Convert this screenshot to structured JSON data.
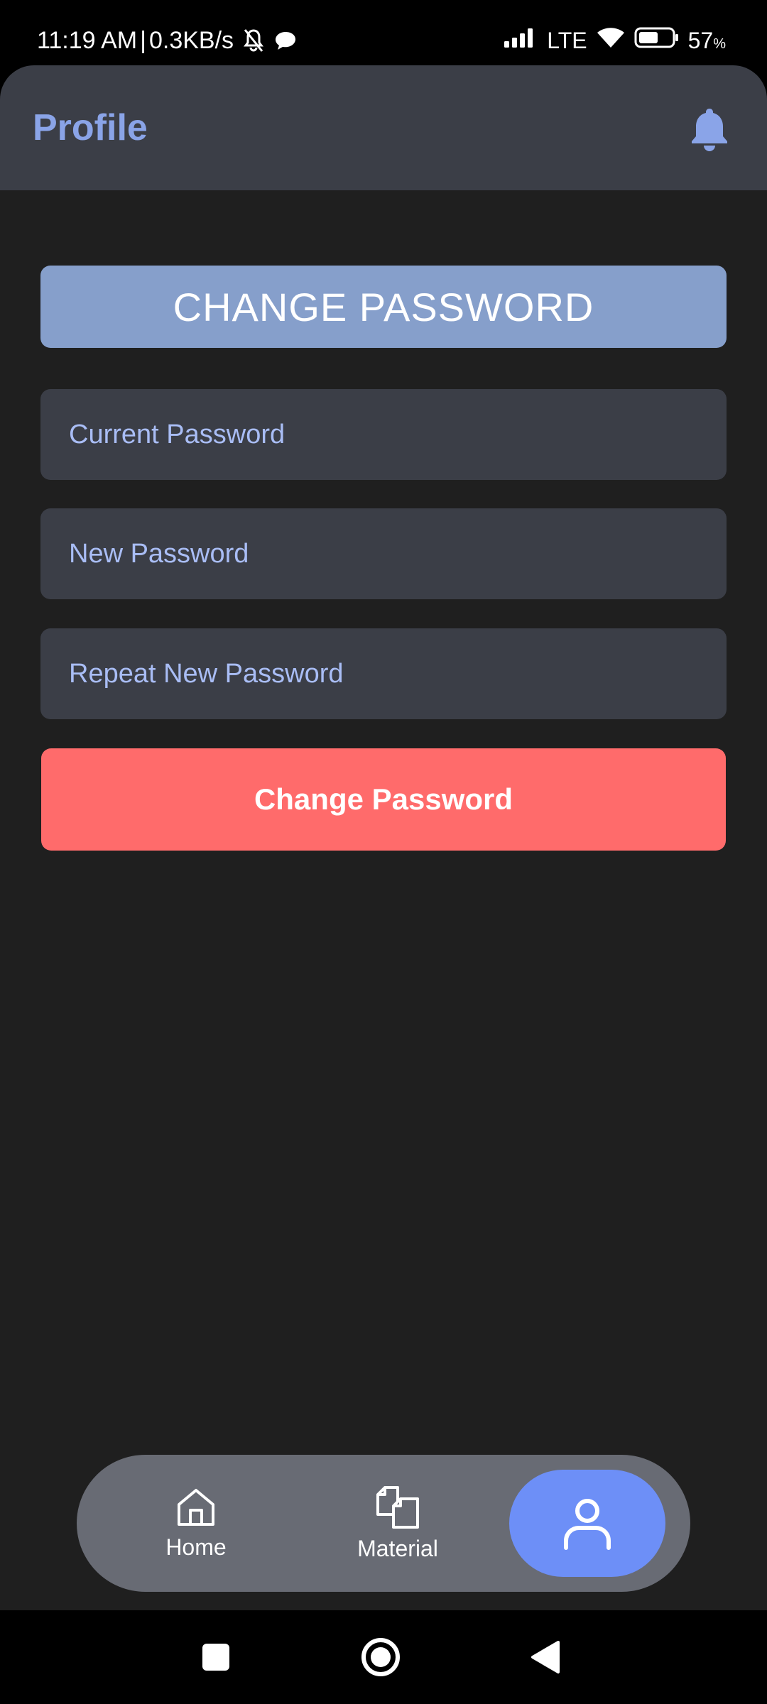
{
  "status_bar": {
    "time": "11:19 AM",
    "separator": "|",
    "network_speed": "0.3KB/s",
    "lte": "LTE",
    "battery_percent": "57",
    "battery_unit": "%"
  },
  "header": {
    "title": "Profile",
    "bell_icon": "bell-icon"
  },
  "section": {
    "title": "CHANGE PASSWORD"
  },
  "form": {
    "current_password": {
      "placeholder": "Current Password",
      "value": ""
    },
    "new_password": {
      "placeholder": "New Password",
      "value": ""
    },
    "repeat_password": {
      "placeholder": "Repeat New Password",
      "value": ""
    },
    "submit_label": "Change Password"
  },
  "bottom_nav": {
    "items": [
      {
        "label": "Home",
        "icon": "home-icon"
      },
      {
        "label": "Material",
        "icon": "documents-icon"
      },
      {
        "label": "",
        "icon": "user-icon",
        "active": true
      }
    ]
  },
  "colors": {
    "background": "#1f1f1f",
    "header": "#3b3e47",
    "accent": "#8aa4e8",
    "banner": "#869fcb",
    "danger": "#ff6b6b",
    "nav_bg": "#686b74",
    "nav_active": "#6d8ff7"
  }
}
